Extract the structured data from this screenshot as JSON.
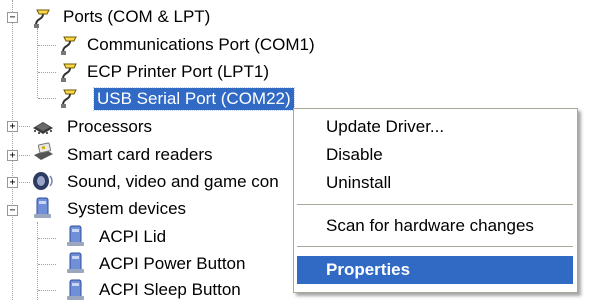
{
  "tree": {
    "ports_category": "Ports (COM & LPT)",
    "ports": [
      "Communications Port (COM1)",
      "ECP Printer Port (LPT1)",
      "USB Serial Port (COM22)"
    ],
    "processors": "Processors",
    "smart_card": "Smart card readers",
    "sound": "Sound, video and game con",
    "system_devices": "System devices",
    "system_items": [
      "ACPI Lid",
      "ACPI Power Button",
      "ACPI Sleep Button"
    ],
    "expand_glyph": "+",
    "collapse_glyph": "−"
  },
  "context_menu": {
    "update_driver": "Update Driver...",
    "disable": "Disable",
    "uninstall": "Uninstall",
    "scan": "Scan for hardware changes",
    "properties": "Properties"
  },
  "colors": {
    "selection": "#316ac5",
    "tree_line": "#a0a0a0"
  },
  "icons": {
    "ports": "port-connector-icon",
    "processors": "processor-chip-icon",
    "smart_card": "smart-card-reader-icon",
    "sound": "speaker-icon",
    "system": "computer-device-icon"
  }
}
